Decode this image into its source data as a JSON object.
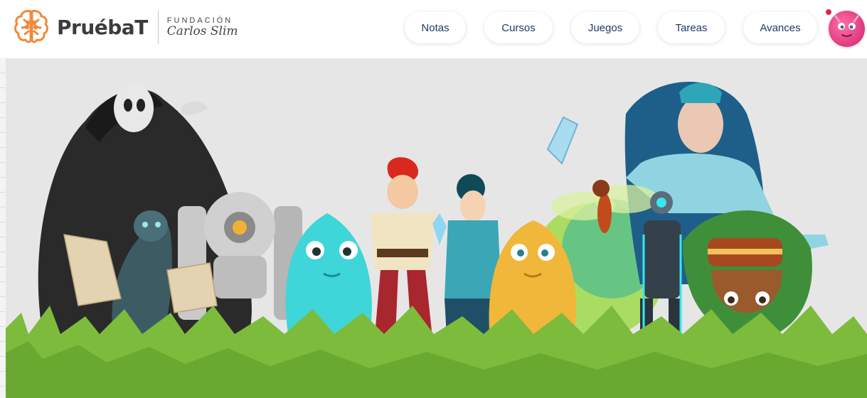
{
  "header": {
    "brand_name": "PruébaT",
    "partner_top": "FUNDACIÓN",
    "partner_bottom": "Carlos Slim",
    "nav": [
      {
        "label": "Notas"
      },
      {
        "label": "Cursos"
      },
      {
        "label": "Juegos"
      },
      {
        "label": "Tareas"
      },
      {
        "label": "Avances"
      }
    ],
    "avatar": {
      "icon": "monster-avatar-icon",
      "notification": true
    }
  },
  "hero": {
    "scene": "cartoon-characters-icon",
    "colors": {
      "sky": "#e6e6e6",
      "grass": "#7dbb3c",
      "brand_orange": "#f08a3c",
      "nav_text": "#1f3a66"
    }
  }
}
